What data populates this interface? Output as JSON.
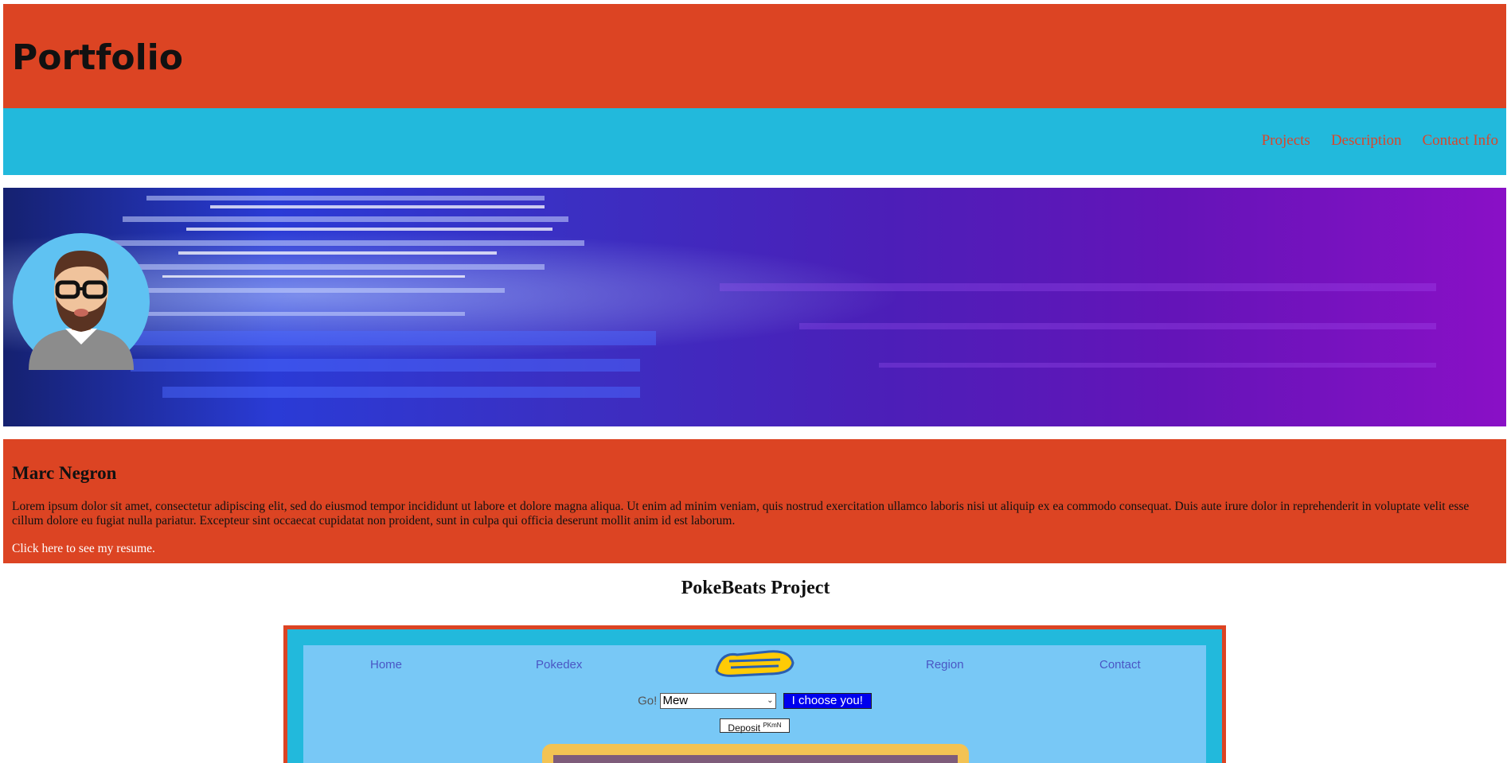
{
  "header": {
    "title": "Portfolio"
  },
  "nav": {
    "items": [
      {
        "label": "Projects"
      },
      {
        "label": "Description"
      },
      {
        "label": "Contact Info"
      }
    ]
  },
  "about": {
    "name": "Marc Negron",
    "bio": "Lorem ipsum dolor sit amet, consectetur adipiscing elit, sed do eiusmod tempor incididunt ut labore et dolore magna aliqua. Ut enim ad minim veniam, quis nostrud exercitation ullamco laboris nisi ut aliquip ex ea commodo consequat. Duis aute irure dolor in reprehenderit in voluptate velit esse cillum dolore eu fugiat nulla pariatur. Excepteur sint occaecat cupidatat non proident, sunt in culpa qui officia deserunt mollit anim id est laborum.",
    "resume_link": "Click here to see my resume."
  },
  "project": {
    "title": "PokeBeats Project",
    "nav": [
      {
        "label": "Home"
      },
      {
        "label": "Pokedex"
      },
      {
        "label": "Region"
      },
      {
        "label": "Contact"
      }
    ],
    "go_label": "Go!",
    "selected_pokemon": "Mew",
    "choose_button": "I choose you!",
    "deposit_label": "Deposit",
    "deposit_sup": "PKmN"
  },
  "colors": {
    "header_bg": "#dc4423",
    "nav_bg": "#22b9dc",
    "nav_link": "#d9462b",
    "project_inner": "#78c8f6",
    "choose_button": "#0000ee"
  },
  "icons": {
    "avatar": "avatar-icon",
    "logo": "pokemon-logo",
    "dropdown": "chevron-down-icon"
  }
}
